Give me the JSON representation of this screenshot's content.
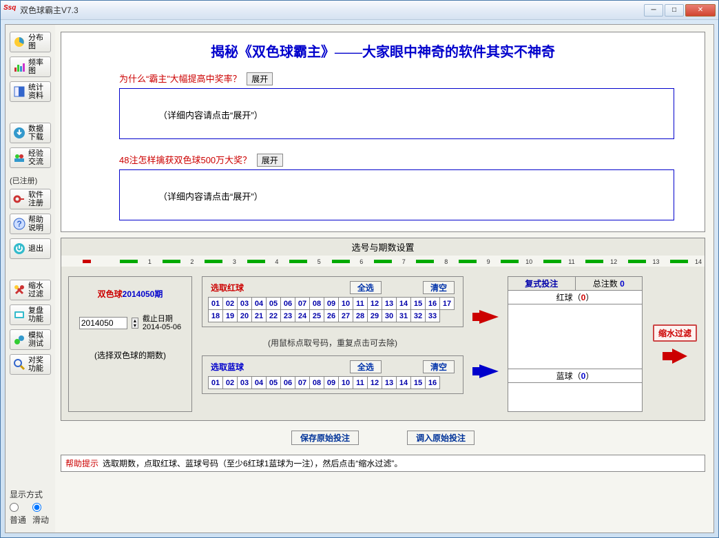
{
  "window": {
    "title": "双色球霸主V7.3"
  },
  "winbtns": {
    "min": "─",
    "max": "□",
    "close": "✕"
  },
  "sidebar": {
    "items": [
      {
        "label": "分布\n图",
        "name": "distribution-chart"
      },
      {
        "label": "频率\n图",
        "name": "frequency-chart"
      },
      {
        "label": "统计\n资料",
        "name": "statistics"
      },
      {
        "label": "数据\n下载",
        "name": "data-download"
      },
      {
        "label": "经验\n交流",
        "name": "experience-exchange"
      }
    ],
    "registered_label": "(已注册)",
    "reg_items": [
      {
        "label": "软件\n注册",
        "name": "software-register"
      },
      {
        "label": "帮助\n说明",
        "name": "help-doc"
      },
      {
        "label": "退出",
        "name": "exit"
      }
    ],
    "bottom_items": [
      {
        "label": "缩水\n过滤",
        "name": "shrink-filter"
      },
      {
        "label": "复盘\n功能",
        "name": "replay"
      },
      {
        "label": "模拟\n测试",
        "name": "simulate"
      },
      {
        "label": "对奖\n功能",
        "name": "check-prize"
      }
    ]
  },
  "display_mode": {
    "label": "显示方式",
    "opt1": "普通",
    "opt2": "滑动"
  },
  "top_panel": {
    "title": "揭秘《双色球霸主》——大家眼中神奇的软件其实不神奇",
    "q1": "为什么“霸主”大幅提高中奖率？",
    "q2": "48注怎样擒获双色球500万大奖？",
    "expand": "展开",
    "detail": "（详细内容请点击“展开”）"
  },
  "section_title": "选号与期数设置",
  "ruler": [
    "1",
    "2",
    "3",
    "4",
    "5",
    "6",
    "7",
    "8",
    "9",
    "10",
    "11",
    "12",
    "13",
    "14"
  ],
  "period": {
    "prefix": "双色球",
    "number": "2014050期",
    "input_value": "2014050",
    "deadline_label": "截止日期",
    "deadline_date": "2014-05-06",
    "hint": "(选择双色球的期数)"
  },
  "red": {
    "label": "选取红球",
    "select_all": "全选",
    "clear": "清空",
    "balls": [
      "01",
      "02",
      "03",
      "04",
      "05",
      "06",
      "07",
      "08",
      "09",
      "10",
      "11",
      "12",
      "13",
      "14",
      "15",
      "16",
      "17",
      "18",
      "19",
      "20",
      "21",
      "22",
      "23",
      "24",
      "25",
      "26",
      "27",
      "28",
      "29",
      "30",
      "31",
      "32",
      "33"
    ]
  },
  "balls_hint": "(用鼠标点取号码，重复点击可去除)",
  "blue": {
    "label": "选取蓝球",
    "select_all": "全选",
    "clear": "清空",
    "balls": [
      "01",
      "02",
      "03",
      "04",
      "05",
      "06",
      "07",
      "08",
      "09",
      "10",
      "11",
      "12",
      "13",
      "14",
      "15",
      "16"
    ]
  },
  "bet": {
    "compound": "复式投注",
    "total_label": "总注数",
    "total_count": "0",
    "red_label": "红球（",
    "red_count": "0",
    "close_paren": "）",
    "blue_label": "蓝球（",
    "blue_count": "0"
  },
  "filter_btn": "缩水过滤",
  "bottom": {
    "save": "保存原始投注",
    "load": "调入原始投注"
  },
  "help": {
    "tag": "帮助提示",
    "text": "选取期数，点取红球、蓝球号码（至少6红球1蓝球为一注），然后点击“缩水过滤”。"
  }
}
